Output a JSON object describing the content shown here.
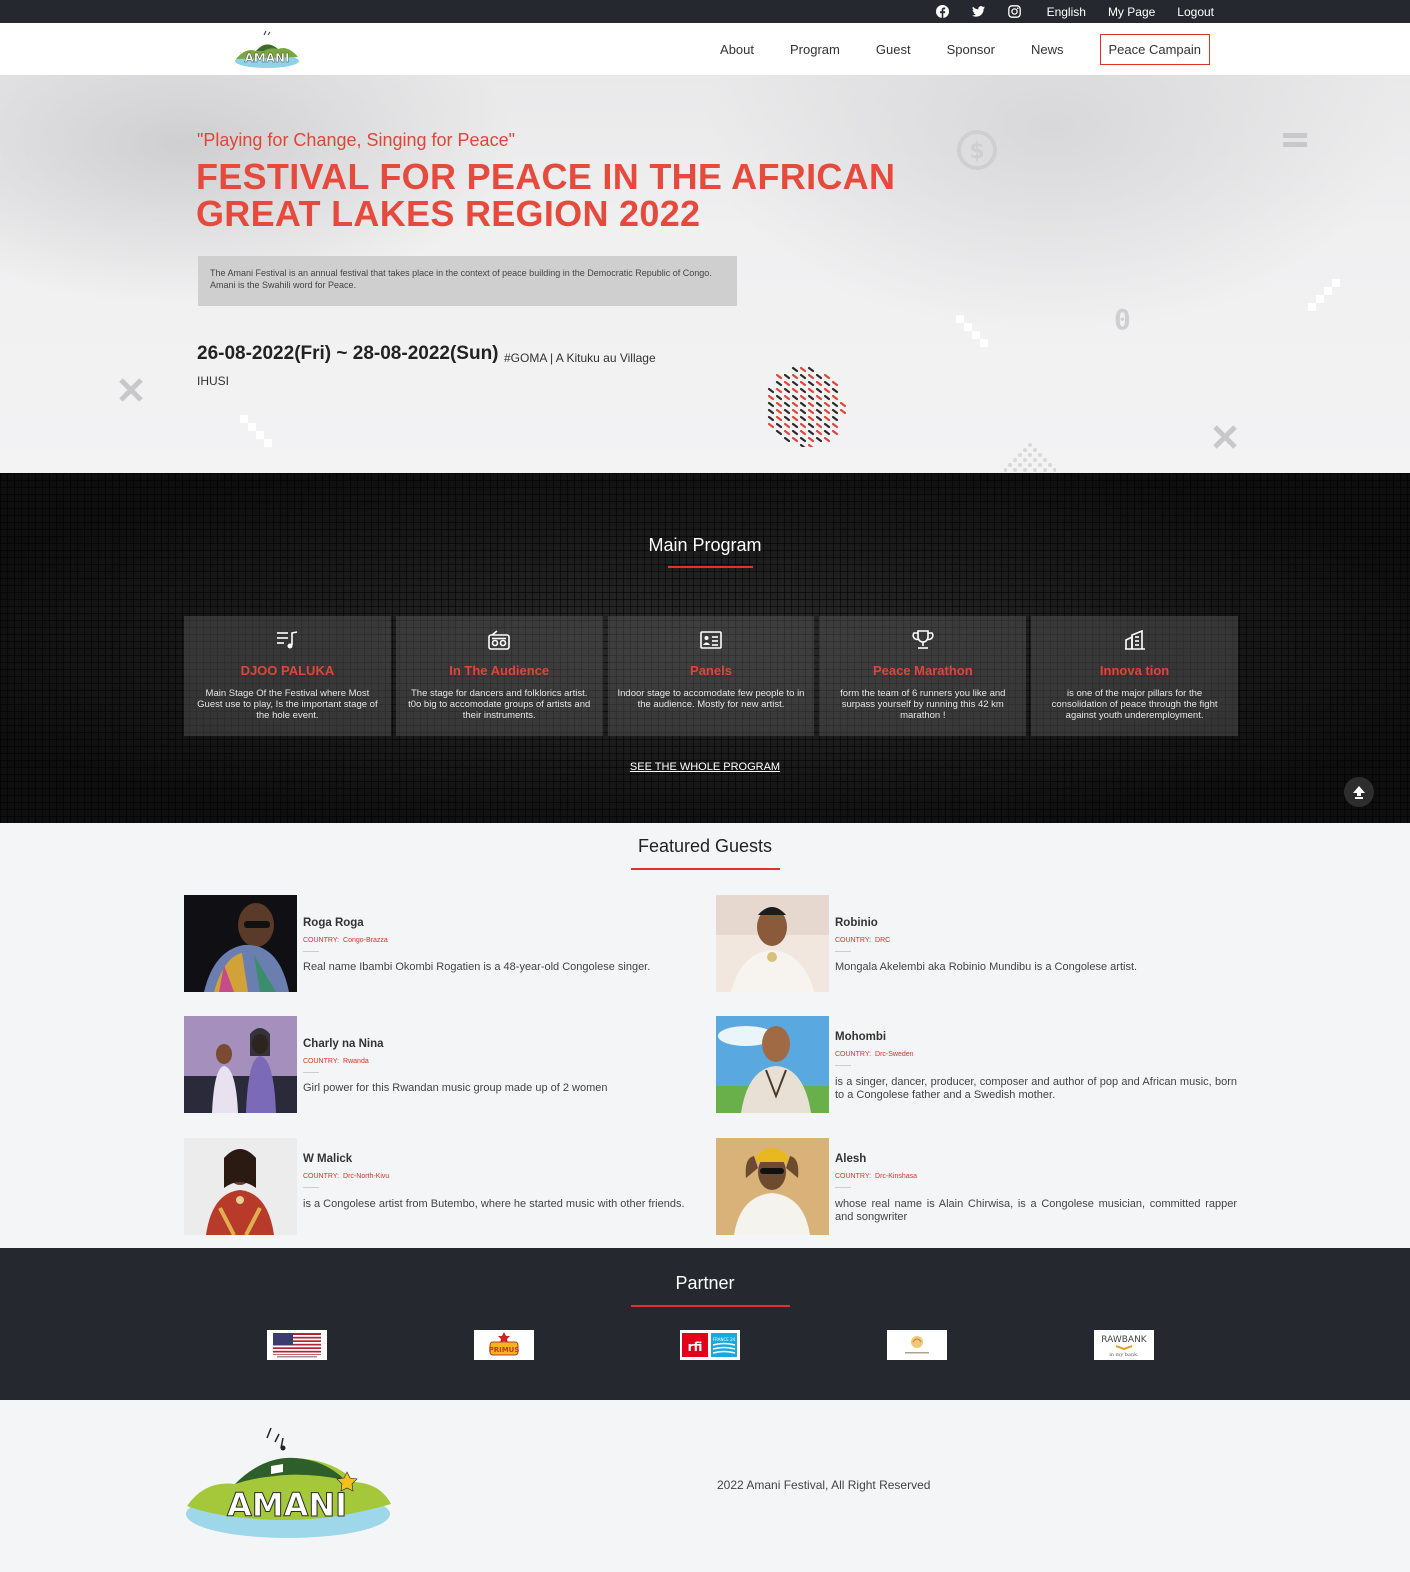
{
  "topbar": {
    "social": [
      "facebook-icon",
      "twitter-icon",
      "instagram-icon"
    ],
    "language": "English",
    "my_page": "My Page",
    "logout": "Logout"
  },
  "header": {
    "logo_text": "AMANI",
    "nav": [
      "About",
      "Program",
      "Guest",
      "Sponsor",
      "News"
    ],
    "campaign": "Peace Campain"
  },
  "hero": {
    "quote": "\"Playing for Change, Singing for Peace\"",
    "title_line1": "FESTIVAL FOR PEACE IN THE AFRICAN",
    "title_line2": "GREAT LAKES REGION 2022",
    "description": "The Amani Festival is an annual festival that takes place in the context of peace building in the Democratic Republic of Congo. Amani is the Swahili word for Peace.",
    "dates": "26-08-2022(Fri) ~ 28-08-2022(Sun)",
    "location": "#GOMA | A Kituku au Village",
    "location2": "IHUSI"
  },
  "program": {
    "title": "Main Program",
    "cards": [
      {
        "icon": "music-list-icon",
        "title": "DJOO PALUKA",
        "desc": "Main Stage Of the Festival where Most Guest use to play, Is the important stage of the hole event."
      },
      {
        "icon": "radio-icon",
        "title": "In The Audience",
        "desc": "The stage for dancers and folklorics artist. t0o big to accomodate groups of artists and their instruments."
      },
      {
        "icon": "presentation-icon",
        "title": "Panels",
        "desc": "Indoor stage to accomodate few people to in the audience. Mostly for new artist."
      },
      {
        "icon": "trophy-icon",
        "title": "Peace Marathon",
        "desc": "form the team of 6 runners you like and surpass yourself by running this 42 km marathon !"
      },
      {
        "icon": "building-icon",
        "title": "Innova tion",
        "desc": "is one of the major pillars for the consolidation of peace through the fight against youth underemployment."
      }
    ],
    "see_all": "SEE THE WHOLE PROGRAM"
  },
  "guests": {
    "title": "Featured Guests",
    "country_label": "COUNTRY:",
    "items": [
      {
        "name": "Roga Roga",
        "country": "Congo-Brazza",
        "desc": "Real name Ibambi Okombi Rogatien is a 48-year-old Congolese singer."
      },
      {
        "name": "Robinio",
        "country": "DRC",
        "desc": "Mongala Akelembi aka Robinio Mundibu is a Congolese artist."
      },
      {
        "name": "Charly na Nina",
        "country": "Rwanda",
        "desc": "Girl power for this Rwandan music group made up of 2 women"
      },
      {
        "name": "Mohombi",
        "country": "Drc-Sweden",
        "desc": "is a singer, dancer, producer, composer and author of pop and African music, born to a Congolese father and a Swedish mother."
      },
      {
        "name": "W Malick",
        "country": "Drc-North-Kivu",
        "desc": "is a Congolese artist from Butembo, where he started music with other friends."
      },
      {
        "name": "Alesh",
        "country": "Drc-Kinshasa",
        "desc": "whose real name is Alain Chirwisa, is a Congolese musician, committed rapper and songwriter"
      }
    ]
  },
  "partner": {
    "title": "Partner",
    "logos": [
      "us-flag-logo",
      "primus-logo",
      "rfi-france24-logo",
      "hotel-logo",
      "rawbank-logo"
    ],
    "primus_text": "PRIMUS",
    "rfi_text": "rfi",
    "f24_text": "FRANCE 24",
    "rawbank_text": "RAWBANK",
    "rawbank_sub": "in my bank."
  },
  "footer": {
    "logo_text": "AMANI",
    "copyright": "2022 Amani Festival, All Right Reserved"
  },
  "hero_deco_digit": "0",
  "colors": {
    "accent": "#e54a3d",
    "dark": "#262830",
    "light_bg": "#f4f5f6"
  }
}
